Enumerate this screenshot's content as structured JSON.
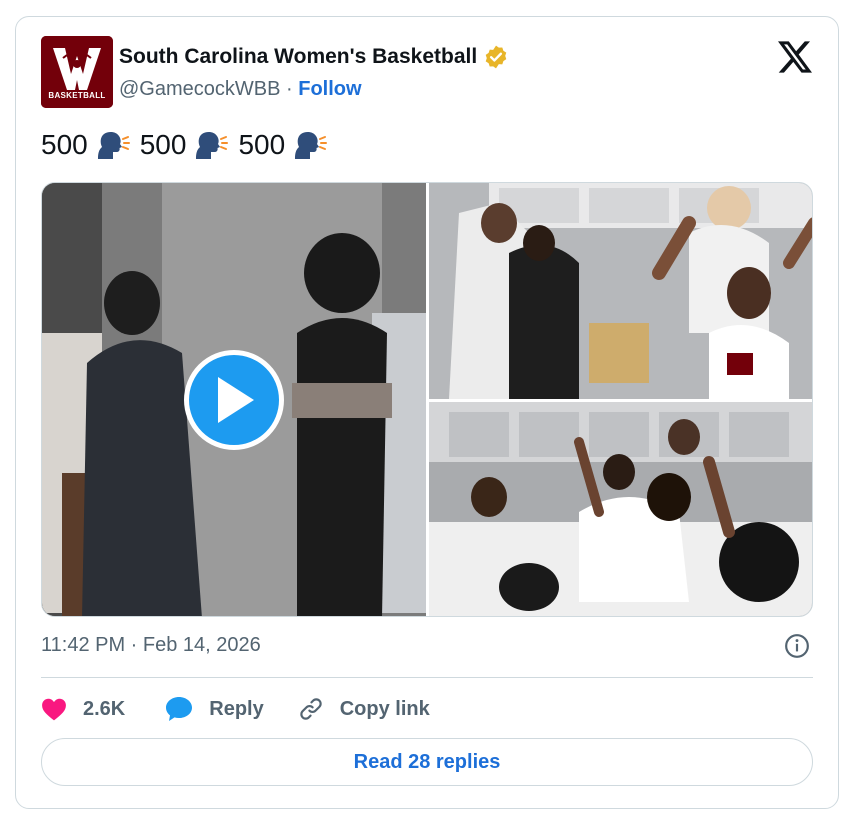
{
  "account": {
    "display_name": "South Carolina Women's Basketball",
    "handle": "@GamecockWBB",
    "separator": "·",
    "follow_label": "Follow",
    "avatar_text": "BASKETBALL",
    "verified": true,
    "brand_color": "#73000a"
  },
  "tweet": {
    "segments": [
      {
        "text": "500",
        "emoji": "speaking-head"
      },
      {
        "text": "500",
        "emoji": "speaking-head"
      },
      {
        "text": "500",
        "emoji": "speaking-head"
      }
    ],
    "timestamp": "11:42 PM · Feb 14, 2026"
  },
  "media": {
    "items": [
      {
        "type": "video",
        "icon": "play-icon"
      },
      {
        "type": "photo"
      },
      {
        "type": "photo"
      }
    ]
  },
  "actions": {
    "likes_count": "2.6K",
    "reply_label": "Reply",
    "copy_link_label": "Copy link"
  },
  "read_replies_label": "Read 28 replies",
  "colors": {
    "link": "#1d6fd8",
    "like": "#f91880",
    "muted": "#536471",
    "border": "#cfd9de",
    "play": "#1d9bf0"
  },
  "icons": {
    "platform": "x-logo-icon",
    "verified": "verified-badge-icon",
    "info": "info-icon",
    "like": "heart-icon",
    "reply": "speech-bubble-icon",
    "copy": "link-icon"
  }
}
